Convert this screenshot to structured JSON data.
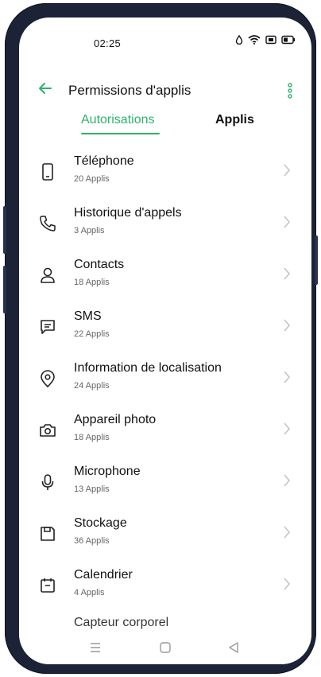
{
  "status": {
    "time": "02:25"
  },
  "appbar": {
    "title": "Permissions d'applis"
  },
  "tabs": [
    {
      "label": "Autorisations",
      "active": true
    },
    {
      "label": "Applis",
      "active": false
    }
  ],
  "items": [
    {
      "label": "Téléphone",
      "count": "20 Applis",
      "icon": "phone-icon"
    },
    {
      "label": "Historique d'appels",
      "count": "3 Applis",
      "icon": "call-log-icon"
    },
    {
      "label": "Contacts",
      "count": "18 Applis",
      "icon": "contacts-icon"
    },
    {
      "label": "SMS",
      "count": "22 Applis",
      "icon": "sms-icon"
    },
    {
      "label": "Information de localisation",
      "count": "24 Applis",
      "icon": "location-icon"
    },
    {
      "label": "Appareil photo",
      "count": "18 Applis",
      "icon": "camera-icon"
    },
    {
      "label": "Microphone",
      "count": "13 Applis",
      "icon": "microphone-icon"
    },
    {
      "label": "Stockage",
      "count": "36 Applis",
      "icon": "storage-icon"
    },
    {
      "label": "Calendrier",
      "count": "4 Applis",
      "icon": "calendar-icon"
    }
  ],
  "partial_item": {
    "label": "Capteur corporel"
  },
  "colors": {
    "accent": "#2db36b",
    "text": "#111111",
    "subtext": "#666666"
  }
}
